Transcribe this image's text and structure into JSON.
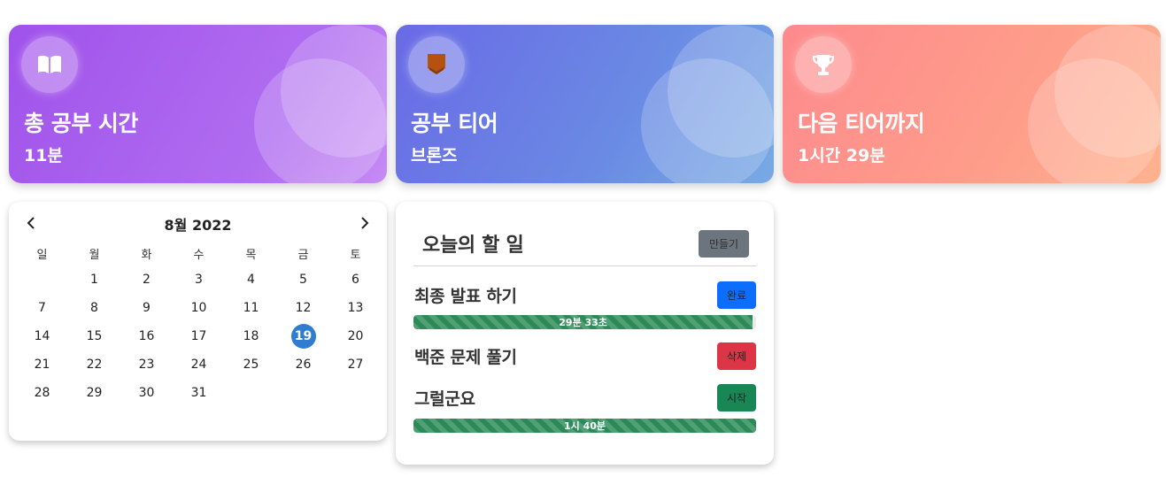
{
  "stats": [
    {
      "title": "총 공부 시간",
      "value": "11분",
      "icon": "book-icon"
    },
    {
      "title": "공부 티어",
      "value": "브론즈",
      "icon": "bronze-badge-icon"
    },
    {
      "title": "다음 티어까지",
      "value": "1시간 29분",
      "icon": "trophy-icon"
    }
  ],
  "calendar": {
    "title": "8월 2022",
    "weekdays": [
      "일",
      "월",
      "화",
      "수",
      "목",
      "금",
      "토"
    ],
    "first_weekday_index": 1,
    "days_in_month": 31,
    "today": 19
  },
  "todo": {
    "title": "오늘의 할 일",
    "create_label": "만들기",
    "tasks": [
      {
        "name": "최종 발표 하기",
        "button": "완료",
        "progress_text": "29분 33초",
        "progress_fraction": 0.99
      },
      {
        "name": "백준 문제 풀기",
        "button": "삭제"
      },
      {
        "name": "그럴군요",
        "button": "시작",
        "progress_text": "1시 40분",
        "progress_fraction": 1.0
      }
    ]
  },
  "colors": {
    "today_circle": "#2f7dd1",
    "btn_complete": "#0d6efd",
    "btn_delete": "#dc3545",
    "btn_start": "#198754",
    "progress": "#2b8a57"
  }
}
